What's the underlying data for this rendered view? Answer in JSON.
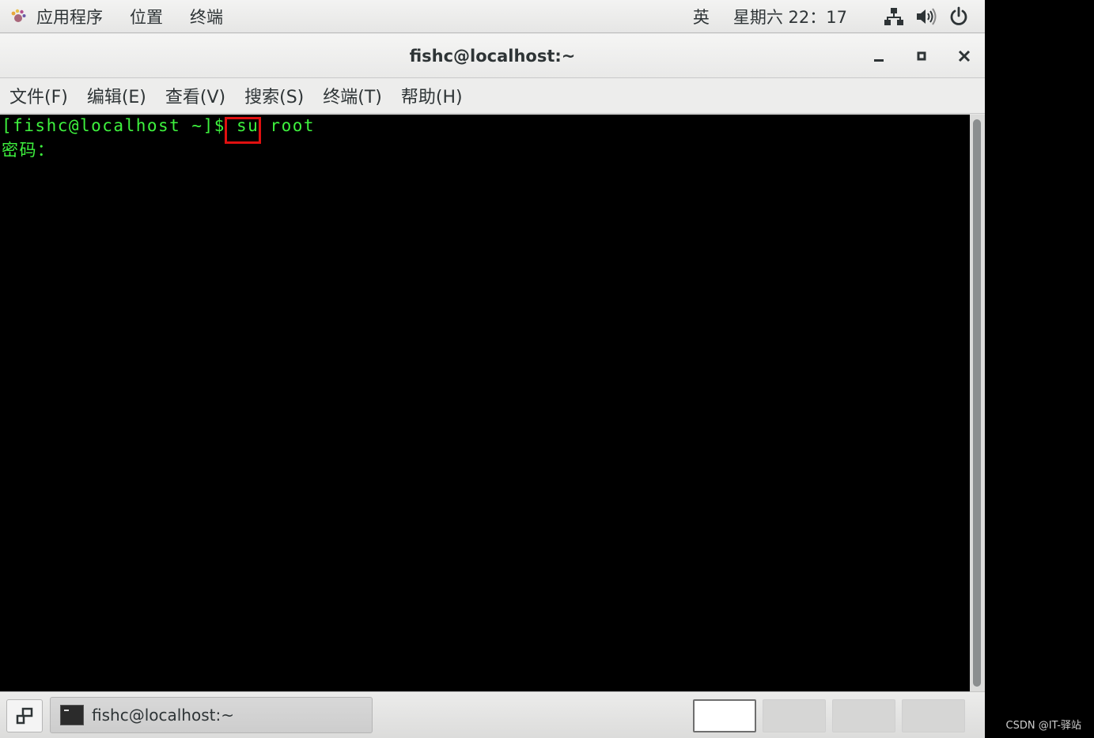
{
  "top_panel": {
    "menu": [
      "应用程序",
      "位置",
      "终端"
    ],
    "input_method": "英",
    "clock": "星期六 22：17",
    "icons": [
      "network-icon",
      "volume-icon",
      "power-icon"
    ]
  },
  "window": {
    "title": "fishc@localhost:~"
  },
  "menubar": [
    "文件(F)",
    "编辑(E)",
    "查看(V)",
    "搜索(S)",
    "终端(T)",
    "帮助(H)"
  ],
  "terminal": {
    "lines": [
      "[fishc@localhost ~]$ su root",
      "密码："
    ],
    "highlighted_token": "su",
    "text_color": "#3ef23e",
    "highlight_color": "#e01010"
  },
  "taskbar": {
    "task_label": "fishc@localhost:~",
    "workspaces": 4,
    "active_workspace": 1
  },
  "watermark": "CSDN @IT-驿站"
}
